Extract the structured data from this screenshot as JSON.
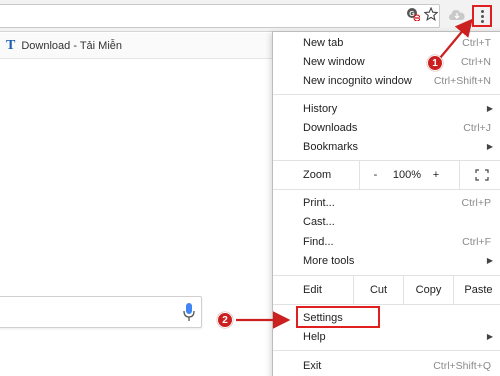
{
  "bookmark_bar": {
    "items": [
      {
        "icon": "T",
        "label": "Download - Tải Miễn"
      }
    ]
  },
  "toolbar": {
    "icons": [
      "translate-blocked-icon",
      "star-icon",
      "extension-icon",
      "chrome-menu-icon"
    ]
  },
  "menu": {
    "new_tab": {
      "label": "New tab",
      "shortcut": "Ctrl+T"
    },
    "new_window": {
      "label": "New window",
      "shortcut": "Ctrl+N"
    },
    "new_incognito": {
      "label": "New incognito window",
      "shortcut": "Ctrl+Shift+N"
    },
    "history": {
      "label": "History"
    },
    "downloads": {
      "label": "Downloads",
      "shortcut": "Ctrl+J"
    },
    "bookmarks": {
      "label": "Bookmarks"
    },
    "zoom": {
      "label": "Zoom",
      "minus": "-",
      "value": "100%",
      "plus": "+"
    },
    "print": {
      "label": "Print...",
      "shortcut": "Ctrl+P"
    },
    "cast": {
      "label": "Cast..."
    },
    "find": {
      "label": "Find...",
      "shortcut": "Ctrl+F"
    },
    "more_tools": {
      "label": "More tools"
    },
    "edit": {
      "label": "Edit",
      "cut": "Cut",
      "copy": "Copy",
      "paste": "Paste"
    },
    "settings": {
      "label": "Settings"
    },
    "help": {
      "label": "Help"
    },
    "exit": {
      "label": "Exit",
      "shortcut": "Ctrl+Shift+Q"
    }
  },
  "annotations": {
    "step1": "1",
    "step2": "2",
    "color": "#cc1f1f"
  }
}
